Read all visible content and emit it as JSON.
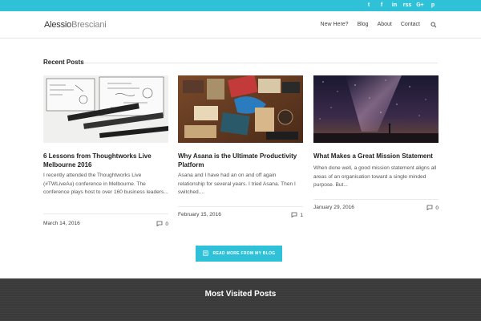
{
  "social": {
    "icons": [
      "twitter-icon",
      "facebook-icon",
      "linkedin-icon",
      "rss-icon",
      "google-plus-icon",
      "pinterest-icon"
    ],
    "glyphs": [
      "t",
      "f",
      "in",
      "rss",
      "G+",
      "p"
    ]
  },
  "header": {
    "logo_first": "Alessio",
    "logo_last": "Bresciani",
    "nav": [
      "New Here?",
      "Blog",
      "About",
      "Contact"
    ]
  },
  "section": {
    "heading": "Recent Posts"
  },
  "posts": [
    {
      "title": "6 Lessons from Thoughtworks Live Melbourne 2016",
      "excerpt": "I recently attended the Thoughtworks Live (#TWLiveAu) conference in Melbourne. The conference plays host to over 160 business leaders...",
      "date": "March 14, 2016",
      "comments": "0"
    },
    {
      "title": "Why Asana is the Ultimate Productivity Platform",
      "excerpt": "Asana and I have had an on and off again relationship for several years. I tried Asana. Then I switched....",
      "date": "February 15, 2016",
      "comments": "1"
    },
    {
      "title": "What Makes a Great Mission Statement",
      "excerpt": "When done well, a good mission statement aligns all areas of an organisation toward a single minded purpose. But...",
      "date": "January 29, 2016",
      "comments": "0"
    }
  ],
  "more_button": {
    "label": "READ MORE FROM MY BLOG"
  },
  "footer": {
    "heading": "Most Visited Posts"
  },
  "colors": {
    "accent": "#2fc1d8",
    "footer_bg": "#3a3a3a"
  }
}
